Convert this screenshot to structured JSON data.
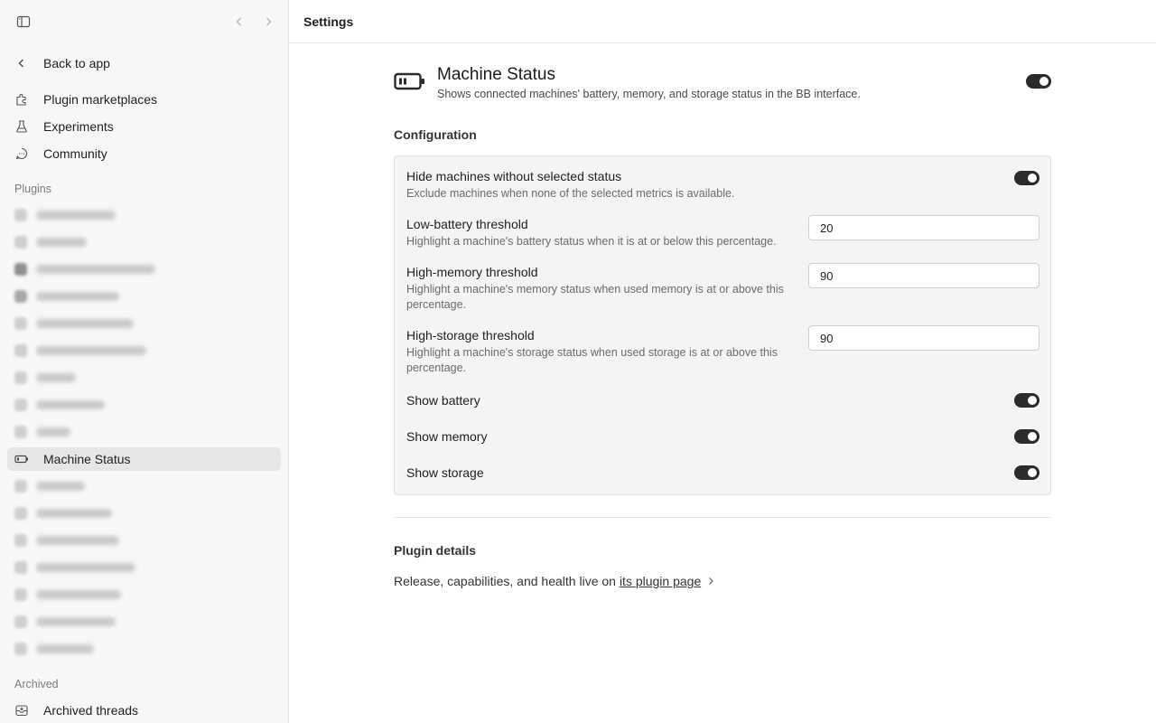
{
  "header": {
    "title": "Settings"
  },
  "sidebar": {
    "back_label": "Back to app",
    "nav": [
      {
        "label": "Plugin marketplaces",
        "icon": "puzzle-icon"
      },
      {
        "label": "Experiments",
        "icon": "flask-icon"
      },
      {
        "label": "Community",
        "icon": "chat-bubble-icon"
      }
    ],
    "plugins_heading": "Plugins",
    "active_plugin": {
      "label": "Machine Status",
      "icon": "battery-icon"
    },
    "archived_heading": "Archived",
    "archived_item": {
      "label": "Archived threads",
      "icon": "archive-icon"
    }
  },
  "plugin": {
    "name": "Machine Status",
    "description": "Shows connected machines' battery, memory, and storage status in the BB interface.",
    "enabled": true
  },
  "configuration": {
    "title": "Configuration",
    "hide_machines": {
      "label": "Hide machines without selected status",
      "help": "Exclude machines when none of the selected metrics is available.",
      "enabled": true
    },
    "low_battery": {
      "label": "Low-battery threshold",
      "help": "Highlight a machine's battery status when it is at or below this percentage.",
      "value": "20"
    },
    "high_memory": {
      "label": "High-memory threshold",
      "help": "Highlight a machine's memory status when used memory is at or above this percentage.",
      "value": "90"
    },
    "high_storage": {
      "label": "High-storage threshold",
      "help": "Highlight a machine's storage status when used storage is at or above this percentage.",
      "value": "90"
    },
    "show_battery": {
      "label": "Show battery",
      "enabled": true
    },
    "show_memory": {
      "label": "Show memory",
      "enabled": true
    },
    "show_storage": {
      "label": "Show storage",
      "enabled": true
    }
  },
  "details": {
    "title": "Plugin details",
    "text": "Release, capabilities, and health live on",
    "link": "its plugin page"
  }
}
